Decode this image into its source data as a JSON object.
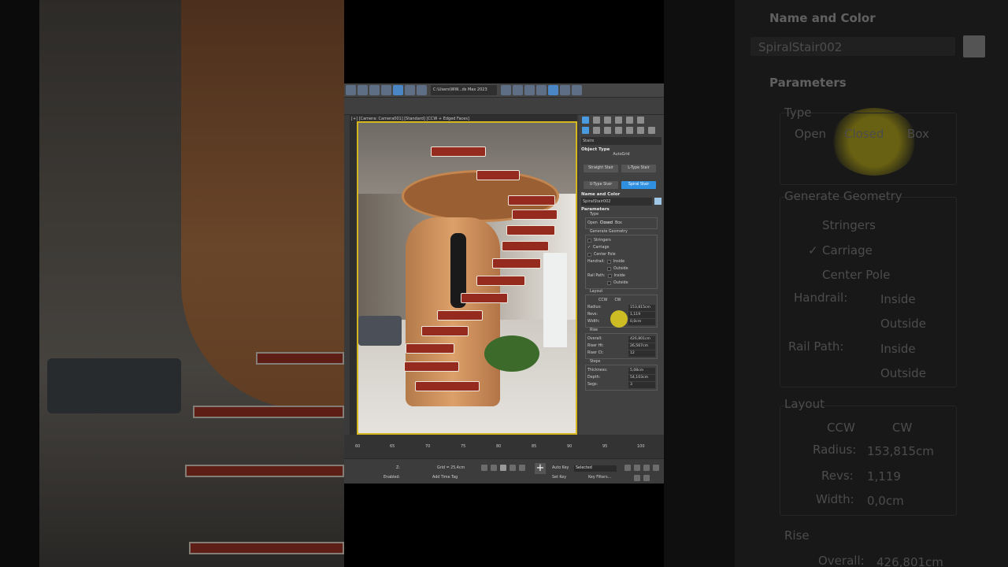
{
  "toolbar": {
    "project_path": "C:\\Users\\WW...ds Max 2023",
    "icons": [
      "new-scene-icon",
      "open-icon",
      "save-icon",
      "undo-icon",
      "redo-icon",
      "link-icon",
      "folder-icon",
      "render-icon"
    ]
  },
  "viewport": {
    "label": "[+] [Camera: Camera001] [Standard] [CCW + Edged Faces]"
  },
  "command_panel": {
    "category": "Stairs",
    "object_type": {
      "title": "Object Type",
      "autogrid": "AutoGrid",
      "buttons": [
        "Straight Stair",
        "L-Type Stair",
        "U-Type Stair",
        "Spiral Stair"
      ],
      "active": "Spiral Stair"
    },
    "name_color": {
      "title": "Name and Color",
      "name_value": "SpiralStair002",
      "color": "#9fc7e8"
    },
    "parameters": {
      "title": "Parameters",
      "type_label": "Type",
      "type_options": [
        "Open",
        "Closed",
        "Box"
      ],
      "type_selected": "Closed",
      "generate_geometry": "Generate Geometry",
      "stringers": "Stringers",
      "carriage": "Carriage",
      "center_pole": "Center Pole",
      "handrail": "Handrail:",
      "rail_path": "Rail Path:",
      "inside": "Inside",
      "outside": "Outside",
      "layout_label": "Layout",
      "ccw": "CCW",
      "cw": "CW",
      "radius_label": "Radius:",
      "radius_value": "153,815cm",
      "revs_label": "Revs:",
      "revs_value": "1,119",
      "width_label": "Width:",
      "width_value": "0,0cm",
      "rise_label": "Rise",
      "overall_label": "Overall:",
      "overall_value": "426,801cm",
      "riser_ht_label": "Riser Ht:",
      "riser_ht_value": "26,567cm",
      "riser_ct_label": "Riser Ct:",
      "riser_ct_value": "12",
      "steps_label": "Steps",
      "thickness_label": "Thickness:",
      "thickness_value": "5,08cm",
      "depth_label": "Depth:",
      "depth_value": "54,103cm",
      "segs_label": "Segs:",
      "segs_value": "3"
    }
  },
  "timeline": {
    "ticks": [
      "60",
      "65",
      "70",
      "75",
      "80",
      "85",
      "90",
      "95",
      "100"
    ]
  },
  "statusbar": {
    "grid": "Grid = 25,4cm",
    "z_label": "Z:",
    "enabled": "Enabled:",
    "add_time_tag": "Add Time Tag",
    "auto_key": "Auto Key",
    "selected": "Selected",
    "set_key": "Set Key",
    "key_filters": "Key Filters..."
  },
  "backdrop_right": {
    "name_color": "Name and Color",
    "name_value": "SpiralStair002",
    "parameters": "Parameters",
    "type": "Type",
    "open": "Open",
    "closed": "Closed",
    "box": "Box",
    "generate_geometry": "Generate Geometry",
    "stringers": "Stringers",
    "carriage": "Carriage",
    "center_pole": "Center Pole",
    "handrail": "Handrail:",
    "inside": "Inside",
    "outside": "Outside",
    "rail_path": "Rail Path:",
    "layout": "Layout",
    "ccw": "CCW",
    "cw": "CW",
    "radius": "Radius:",
    "radius_value": "153,815cm",
    "revs": "Revs:",
    "revs_value": "1,119",
    "width": "Width:",
    "width_value": "0,0cm",
    "rise": "Rise",
    "overall": "Overall:",
    "overall_value": "426,801cm"
  }
}
